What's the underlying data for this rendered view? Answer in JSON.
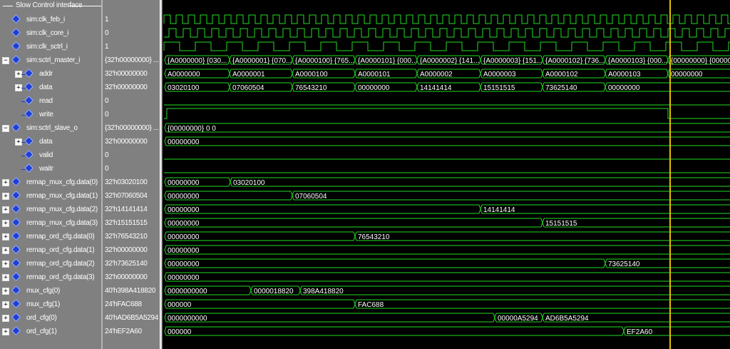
{
  "group": {
    "label": "Slow Control interface"
  },
  "signals": [
    {
      "name": "sim:clk_feb_i",
      "value": "1",
      "indent": 1,
      "expand": "",
      "type": "clock",
      "period": 17,
      "high": 9
    },
    {
      "name": "sim:clk_core_i",
      "value": "0",
      "indent": 1,
      "expand": "",
      "type": "clock",
      "period": 20,
      "high": 10,
      "phase": 7
    },
    {
      "name": "sim:clk_sctrl_i",
      "value": "1",
      "indent": 1,
      "expand": "",
      "type": "clock",
      "period": 44,
      "high": 22
    },
    {
      "name": "sim:sctrl_master_i",
      "value": "{32'h00000000} ...",
      "indent": 0,
      "expand": "-",
      "type": "bus",
      "segments": [
        [
          "{A0000000} {030..."
        ],
        [
          "{A0000001} {070..."
        ],
        [
          "{A0000100} {765..."
        ],
        [
          "{A0000101} {000..."
        ],
        [
          "{A0000002} {141..."
        ],
        [
          "{A0000003} {151..."
        ],
        [
          "{A0000102} {736..."
        ],
        [
          "{A0000103} {000..."
        ],
        [
          "{00000000} {000000"
        ]
      ]
    },
    {
      "name": "addr",
      "value": "32'h00000000",
      "indent": 2,
      "expand": "+",
      "type": "bus",
      "segments": [
        [
          "A0000000"
        ],
        [
          "A0000001"
        ],
        [
          "A0000100"
        ],
        [
          "A0000101"
        ],
        [
          "A0000002"
        ],
        [
          "A0000003"
        ],
        [
          "A0000102"
        ],
        [
          "A0000103"
        ],
        [
          "00000000"
        ]
      ]
    },
    {
      "name": "data",
      "value": "32'h00000000",
      "indent": 2,
      "expand": "+",
      "type": "bus",
      "segments": [
        [
          "03020100"
        ],
        [
          "07060504"
        ],
        [
          "76543210"
        ],
        [
          "00000000"
        ],
        [
          "14141414"
        ],
        [
          "15151515"
        ],
        [
          "73625140"
        ],
        [
          "00000000"
        ]
      ]
    },
    {
      "name": "read",
      "value": "0",
      "indent": 2,
      "expand": "",
      "type": "flat"
    },
    {
      "name": "write",
      "value": "0",
      "indent": 2,
      "expand": "",
      "type": "write"
    },
    {
      "name": "sim:sctrl_slave_o",
      "value": "{32'h00000000} ...",
      "indent": 0,
      "expand": "-",
      "type": "bus",
      "segments": [
        [
          "{00000000} 0 0"
        ]
      ]
    },
    {
      "name": "data",
      "value": "32'h00000000",
      "indent": 2,
      "expand": "+",
      "type": "bus",
      "segments": [
        [
          "00000000"
        ]
      ]
    },
    {
      "name": "valid",
      "value": "0",
      "indent": 2,
      "expand": "",
      "type": "flat"
    },
    {
      "name": "waitr",
      "value": "0",
      "indent": 2,
      "expand": "",
      "type": "flat"
    },
    {
      "name": "remap_mux_cfg.data(0)",
      "value": "32'h03020100",
      "indent": 0,
      "expand": "+",
      "type": "bus",
      "segments": [
        [
          "00000000"
        ],
        [
          "03020100"
        ]
      ]
    },
    {
      "name": "remap_mux_cfg.data(1)",
      "value": "32'h07060504",
      "indent": 0,
      "expand": "+",
      "type": "bus",
      "segments": [
        [
          "00000000"
        ],
        [
          "07060504"
        ]
      ]
    },
    {
      "name": "remap_mux_cfg.data(2)",
      "value": "32'h14141414",
      "indent": 0,
      "expand": "+",
      "type": "bus",
      "segments": [
        [
          "00000000"
        ],
        [
          "14141414"
        ]
      ]
    },
    {
      "name": "remap_mux_cfg.data(3)",
      "value": "32'h15151515",
      "indent": 0,
      "expand": "+",
      "type": "bus",
      "segments": [
        [
          "00000000"
        ],
        [
          "15151515"
        ]
      ]
    },
    {
      "name": "remap_ord_cfg.data(0)",
      "value": "32'h76543210",
      "indent": 0,
      "expand": "+",
      "type": "bus",
      "segments": [
        [
          "00000000"
        ],
        [
          "76543210"
        ]
      ]
    },
    {
      "name": "remap_ord_cfg.data(1)",
      "value": "32'h00000000",
      "indent": 0,
      "expand": "+",
      "type": "bus",
      "segments": [
        [
          "00000000"
        ]
      ]
    },
    {
      "name": "remap_ord_cfg.data(2)",
      "value": "32'h73625140",
      "indent": 0,
      "expand": "+",
      "type": "bus",
      "segments": [
        [
          "00000000"
        ],
        [
          "73625140"
        ]
      ]
    },
    {
      "name": "remap_ord_cfg.data(3)",
      "value": "32'h00000000",
      "indent": 0,
      "expand": "+",
      "type": "bus",
      "segments": [
        [
          "00000000"
        ]
      ]
    },
    {
      "name": "mux_cfg(0)",
      "value": "40'h398A418820",
      "indent": 0,
      "expand": "+",
      "type": "bus",
      "segments": [
        [
          "0000000000"
        ],
        [
          "0000018820"
        ],
        [
          "398A418820"
        ]
      ]
    },
    {
      "name": "mux_cfg(1)",
      "value": "24'hFAC688",
      "indent": 0,
      "expand": "+",
      "type": "bus",
      "segments": [
        [
          "000000"
        ],
        [
          "FAC688"
        ]
      ]
    },
    {
      "name": "ord_cfg(0)",
      "value": "40'hAD6B5A5294",
      "indent": 0,
      "expand": "+",
      "type": "bus",
      "segments": [
        [
          "0000000000"
        ],
        [
          "00000A5294"
        ],
        [
          "AD6B5A5294"
        ]
      ]
    },
    {
      "name": "ord_cfg(1)",
      "value": "24'hEF2A60",
      "indent": 0,
      "expand": "+",
      "type": "bus",
      "segments": [
        [
          "000000"
        ],
        [
          "EF2A60"
        ]
      ]
    }
  ],
  "colors": {
    "wave": "#22dd22",
    "cursor": "#e0c000",
    "panel": "#808080",
    "diamond": "#1f3fd4"
  },
  "icons": {
    "signal": "diamond-signal-icon",
    "expand": "plus-box-icon",
    "collapse": "minus-box-icon"
  }
}
